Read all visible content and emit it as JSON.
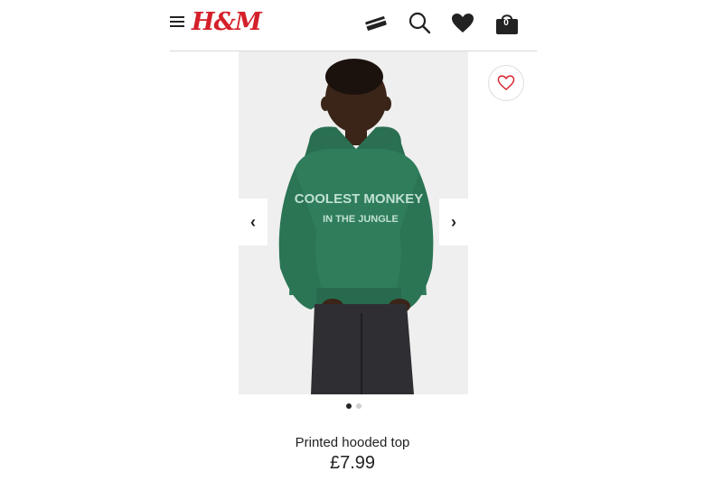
{
  "header": {
    "brand": "H&M",
    "brand_color": "#d4202a",
    "icons": [
      "menu-icon",
      "membership-card-icon",
      "search-icon",
      "favourites-heart-icon",
      "shopping-bag-icon"
    ],
    "bag_count": "0"
  },
  "gallery": {
    "image_alt": "Child wearing green hooded top",
    "hoodie_print_line1": "COOLEST MONKEY",
    "hoodie_print_line2": "IN THE JUNGLE",
    "prev_symbol": "‹",
    "next_symbol": "›",
    "total_images": 2,
    "active_image": 1
  },
  "product": {
    "name": "Printed hooded top",
    "price": "£7.99"
  },
  "colors": {
    "hoodie": "#2f7d5b",
    "background": "#efefef",
    "fav_heart": "#d4202a"
  }
}
